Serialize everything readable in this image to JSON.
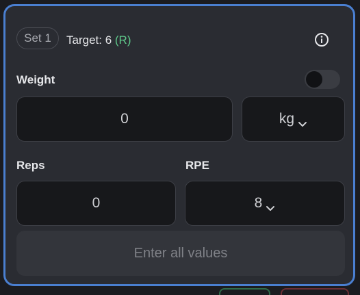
{
  "set": {
    "badge_label": "Set 1",
    "target_text": "Target: 6",
    "target_suffix": "(R)"
  },
  "weight": {
    "label": "Weight",
    "value": "0",
    "unit": "kg",
    "toggle_on": false
  },
  "reps": {
    "label": "Reps",
    "value": "0"
  },
  "rpe": {
    "label": "RPE",
    "value": "8"
  },
  "submit_label": "Enter all values",
  "colors": {
    "accent_border": "#4a7fd0",
    "target_suffix": "#5fc98b",
    "card_bg": "#2a2c32",
    "input_bg": "#17181b"
  },
  "icons": [
    "info-icon",
    "chevron-down-icon"
  ]
}
